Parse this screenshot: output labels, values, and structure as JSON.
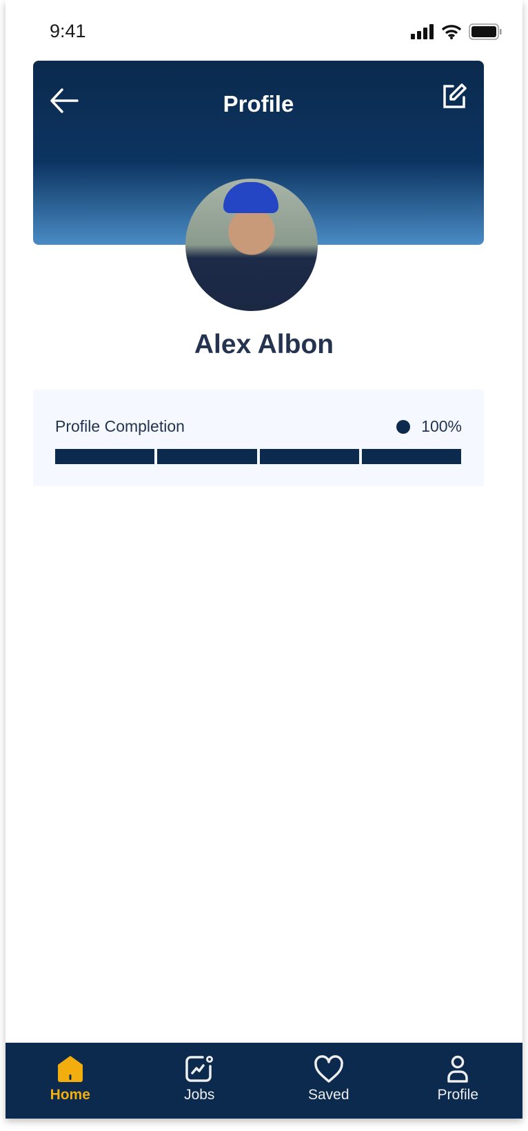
{
  "status": {
    "time": "9:41"
  },
  "header": {
    "title": "Profile"
  },
  "profile": {
    "name": "Alex Albon"
  },
  "completion": {
    "label": "Profile Completion",
    "value": "100%",
    "percent": 100,
    "segments": 4,
    "filled": 4
  },
  "nav": {
    "items": [
      {
        "label": "Home",
        "icon": "home-icon",
        "active": true
      },
      {
        "label": "Jobs",
        "icon": "jobs-icon"
      },
      {
        "label": "Saved",
        "icon": "heart-icon"
      },
      {
        "label": "Profile",
        "icon": "user-icon"
      }
    ]
  },
  "colors": {
    "primary": "#0b2a4d",
    "accent": "#f2ae0f",
    "panel": "#f5f9ff"
  }
}
